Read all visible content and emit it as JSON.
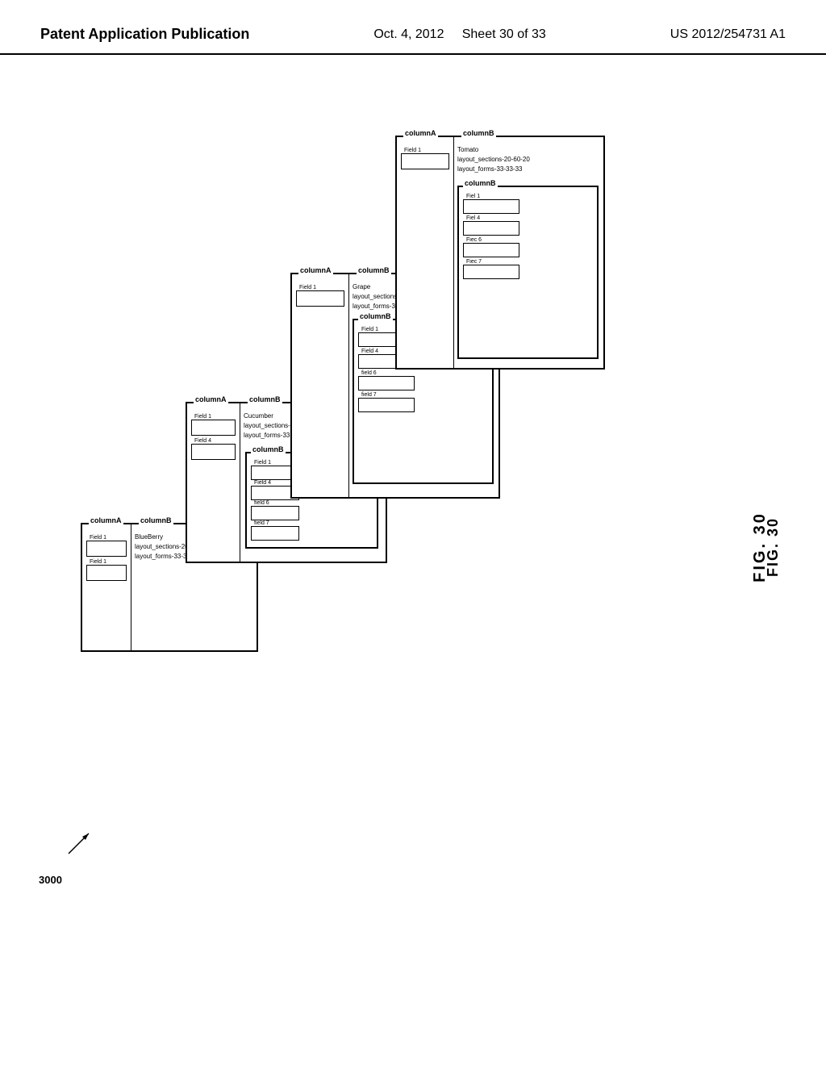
{
  "header": {
    "left": "Patent Application Publication",
    "date": "Oct. 4, 2012",
    "sheet": "Sheet 30 of 33",
    "patent": "US 2012/254731 A1"
  },
  "fig": {
    "label": "FIG. 30",
    "ref": "3000"
  },
  "boxes": {
    "box1": {
      "colA_label": "columnA",
      "colB_label": "columnB",
      "name": "BlueBerry",
      "layout_sections": "layout_sections-20-60-20",
      "layout_forms": "layout_forms-33-33-33",
      "field1": "Field 1",
      "field2": "Field 1"
    },
    "box2": {
      "colA_label": "columnA",
      "colB_label": "columnB",
      "name": "Cucumber",
      "layout_sections": "layout_sections-20-60-20",
      "layout_forms": "layout_forms-33-33-33",
      "field1": "Field 1",
      "field2": "Field 4"
    },
    "box3": {
      "colA_label": "columnA",
      "colB_label": "columnB",
      "name": "Grape",
      "layout_sections": "layout_sections-20-60-20",
      "layout_forms": "layout_forms-33-33-33",
      "field1": "Field 1",
      "field4": "Field 4",
      "field6": "field 6",
      "field7": "field 7"
    },
    "box4": {
      "colA_label": "columnA",
      "colB_label": "columnB",
      "name": "Tomato",
      "layout_sections": "layout_sections-20-60-20",
      "layout_forms": "layout_forms-33-33-33",
      "field1": "Field 1",
      "field4": "Fiel 4",
      "field6": "Fiec 6",
      "field7": "Fiec 7"
    }
  }
}
